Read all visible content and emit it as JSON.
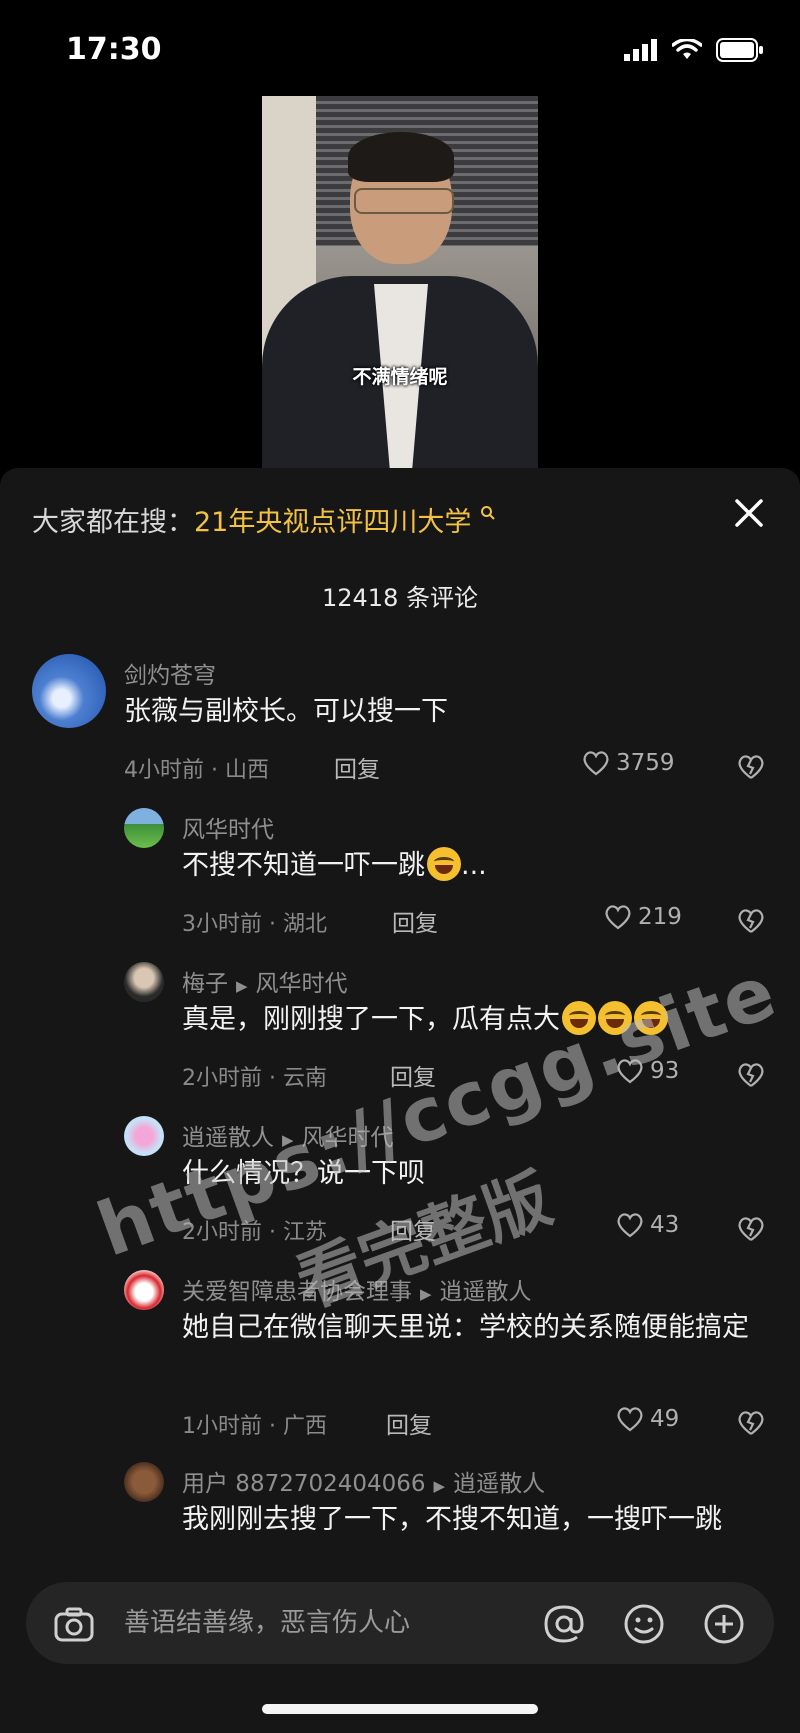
{
  "status_bar": {
    "time": "17:30"
  },
  "video": {
    "caption": "不满情绪呢"
  },
  "panel": {
    "search_prefix": "大家都在搜：",
    "search_query": "21年央视点评四川大学",
    "comment_count": "12418 条评论"
  },
  "comments": [
    {
      "user": "剑灼苍穹",
      "text": "张薇与副校长。可以搜一下",
      "time": "4小时前 · 山西",
      "reply": "回复",
      "likes": "3759"
    },
    {
      "user": "风华时代",
      "text": "不搜不知道一吓一跳",
      "suffix": "...",
      "time": "3小时前 · 湖北",
      "reply": "回复",
      "likes": "219"
    },
    {
      "user": "梅子",
      "reply_to": "风华时代",
      "text": "真是，刚刚搜了一下，瓜有点大",
      "time": "2小时前 · 云南",
      "reply": "回复",
      "likes": "93"
    },
    {
      "user": "逍遥散人",
      "reply_to": "风华时代",
      "text": "什么情况？说一下呗",
      "time": "2小时前 · 江苏",
      "reply": "回复",
      "likes": "43"
    },
    {
      "user": "关爱智障患者协会理事",
      "reply_to": "逍遥散人",
      "text": "她自己在微信聊天里说：学校的关系随便能搞定",
      "time": "1小时前 · 广西",
      "reply": "回复",
      "likes": "49"
    },
    {
      "user": "用户 8872702404066",
      "reply_to": "逍遥散人",
      "text": "我刚刚去搜了一下，不搜不知道，一搜吓一跳"
    }
  ],
  "watermark": {
    "line1": "https://ccgg.site",
    "line2": "看完整版"
  },
  "input": {
    "placeholder": "善语结善缘，恶言伤人心"
  },
  "icons": [
    "signal-icon",
    "wifi-icon",
    "battery-icon",
    "search-icon",
    "close-icon",
    "heart-icon",
    "broken-heart-icon",
    "camera-icon",
    "at-icon",
    "emoji-icon",
    "plus-icon"
  ]
}
